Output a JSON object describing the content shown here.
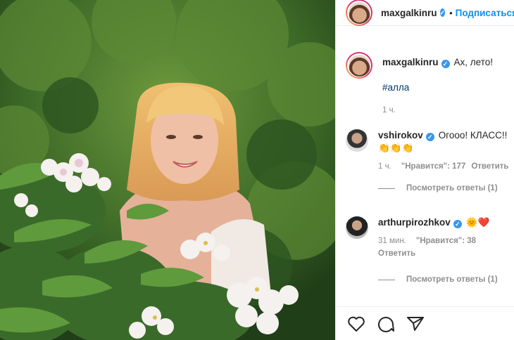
{
  "post": {
    "author": "maxgalkinru",
    "follow_label": "Подписаться",
    "dot": "•",
    "caption": "Ах, лето!",
    "hashtag": "#алла",
    "time": "1 ч."
  },
  "comments": [
    {
      "user": "vshirokov",
      "text": "Огооо! КЛАСС!!",
      "emoji": "👏👏👏",
      "time": "1 ч.",
      "likes": "\"Нравится\": 177",
      "reply": "Ответить",
      "view_replies": "Посмотреть ответы (1)"
    },
    {
      "user": "arthurpirozhkov",
      "text": "🌞❤️",
      "time": "31 мин.",
      "likes": "\"Нравится\": 38",
      "reply": "Ответить",
      "view_replies": "Посмотреть ответы (1)"
    }
  ],
  "icons": {
    "like": "heart-icon",
    "comment": "comment-icon",
    "share": "share-icon",
    "verified": "verified-badge"
  },
  "colors": {
    "link": "#0095f6",
    "verified": "#3897f0",
    "text": "#262626",
    "muted": "#8e8e8e"
  }
}
